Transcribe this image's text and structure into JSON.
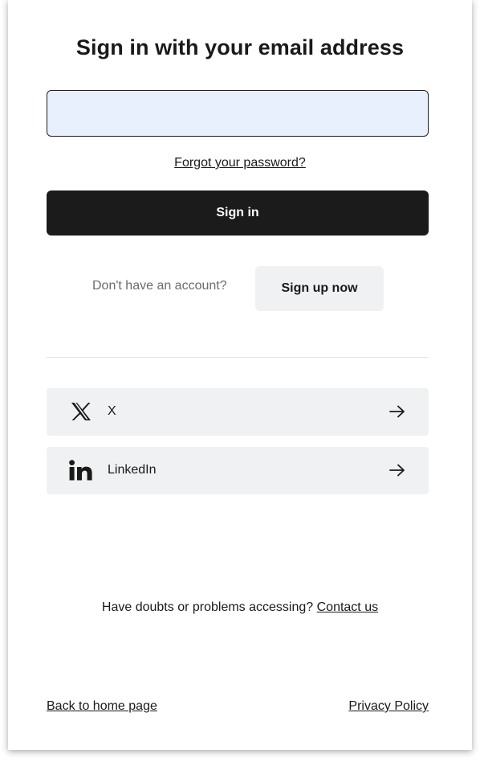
{
  "login": {
    "title": "Sign in with your email address",
    "email_value": "",
    "forgot_link": "Forgot your password?",
    "signin_button": "Sign in",
    "no_account_text": "Don't have an account?",
    "signup_button": "Sign up now"
  },
  "social": [
    {
      "label": "X",
      "icon": "x-logo-icon"
    },
    {
      "label": "LinkedIn",
      "icon": "linkedin-logo-icon"
    }
  ],
  "help": {
    "text": "Have doubts or problems accessing?",
    "contact_link": "Contact us"
  },
  "footer": {
    "back_link": "Back to home page",
    "privacy_link": "Privacy Policy"
  },
  "colors": {
    "primary_button": "#1b1b1b",
    "secondary_button": "#f0f1f2",
    "input_fill": "#e8f0fe"
  }
}
